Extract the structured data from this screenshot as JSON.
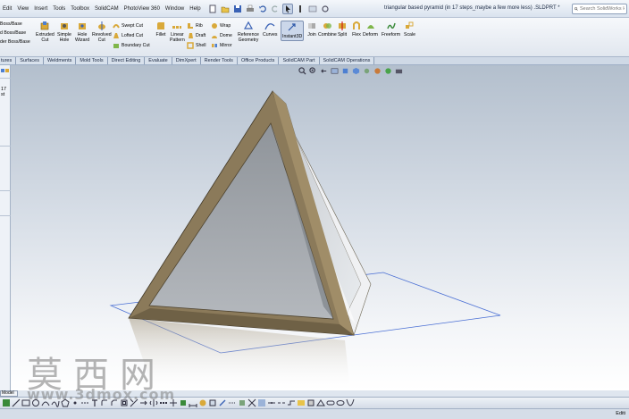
{
  "menu": {
    "items": [
      "Edit",
      "View",
      "Insert",
      "Tools",
      "Toolbox",
      "SolidCAM",
      "PhotoView 360",
      "Window",
      "Help"
    ]
  },
  "document": {
    "title": "triangular based pyramid (in 17 steps_maybe a few more less) .SLDPRT *"
  },
  "search": {
    "placeholder": "Search SolidWorks Help"
  },
  "ribbon": {
    "left_items": [
      "Boss/Base",
      "d Boss/Base",
      "der Boss/Base"
    ],
    "buttons": [
      {
        "label": "Extruded\nCut"
      },
      {
        "label": "Simple\nHole"
      },
      {
        "label": "Hole\nWizard"
      },
      {
        "label": "Revolved\nCut"
      },
      {
        "label": "Fillet"
      },
      {
        "label": "Linear\nPattern"
      },
      {
        "label": "Reference\nGeometry"
      },
      {
        "label": "Curves"
      },
      {
        "label": "Instant3D"
      },
      {
        "label": "Join"
      },
      {
        "label": "Combine"
      },
      {
        "label": "Split"
      },
      {
        "label": "Flex"
      },
      {
        "label": "Deform"
      },
      {
        "label": "Freeform"
      },
      {
        "label": "Scale"
      }
    ],
    "small": {
      "swept_cut": "Swept Cut",
      "lofted_cut": "Lofted Cut",
      "boundary_cut": "Boundary Cut",
      "rib": "Rib",
      "draft": "Draft",
      "shell": "Shell",
      "wrap": "Wrap",
      "dome": "Dome",
      "mirror": "Mirror"
    }
  },
  "tabs": [
    "tures",
    "Surfaces",
    "Weldments",
    "Mold Tools",
    "Direct Editing",
    "Evaluate",
    "DimXpert",
    "Render Tools",
    "Office Products",
    "SolidCAM Part",
    "SolidCAM Operations"
  ],
  "left_panel": {
    "text": "17 st"
  },
  "sheet_tab": {
    "label": "Model"
  },
  "status": {
    "right_text": "Editi"
  },
  "watermark": {
    "cn": "莫西网",
    "url": "www.3dmox.com"
  },
  "colors": {
    "frame_face": "#8b7a5a",
    "frame_dark": "#4f4430",
    "glass": "#9ea3a8",
    "plane": "#4a6fd4",
    "accent": "#7c8fb0"
  }
}
